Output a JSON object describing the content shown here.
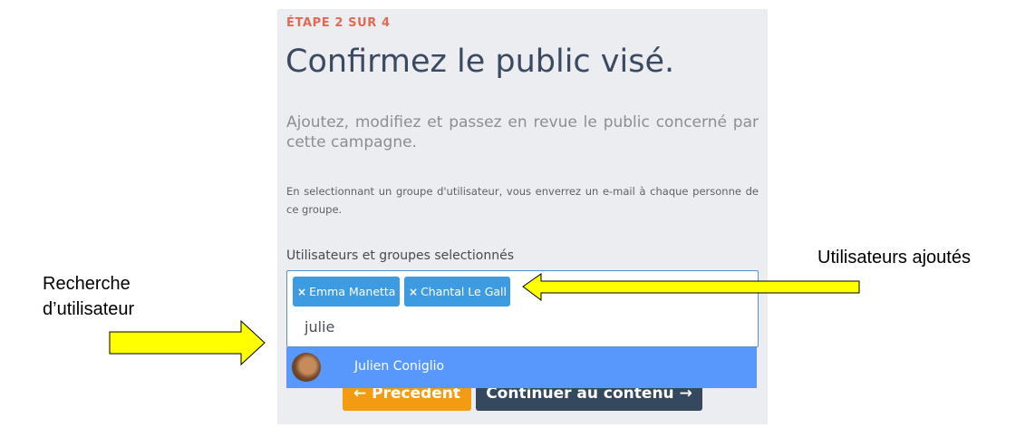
{
  "step_label": "ÉTAPE 2 SUR 4",
  "title": "Confirmez le public visé.",
  "subtitle": "Ajoutez, modifiez et passez en revue le public concerné par cette campagne.",
  "description": "En selectionnant un groupe d'utilisateur, vous enverrez un e-mail à chaque personne de ce groupe.",
  "field_label": "Utilisateurs et groupes selectionnés",
  "selected_tags": [
    {
      "remove_symbol": "×",
      "label": "Emma Manetta"
    },
    {
      "remove_symbol": "×",
      "label": "Chantal Le Gall"
    }
  ],
  "search_value": "julie",
  "dropdown_option": {
    "label": "Julien Coniglio",
    "avatar": "user-avatar-photo"
  },
  "buttons": {
    "prev": "← Précédent",
    "next": "Continuer au contenu →"
  },
  "annotations": {
    "left_label": "Recherche\nd’utilisateur",
    "right_label": "Utilisateurs ajoutés"
  },
  "colors": {
    "accent_step": "#e06a55",
    "tag": "#3d9be1",
    "dropdown_highlight": "#5897fb",
    "prev_button": "#f39c12",
    "next_button": "#34495e",
    "arrow_fill": "#ffff00"
  }
}
